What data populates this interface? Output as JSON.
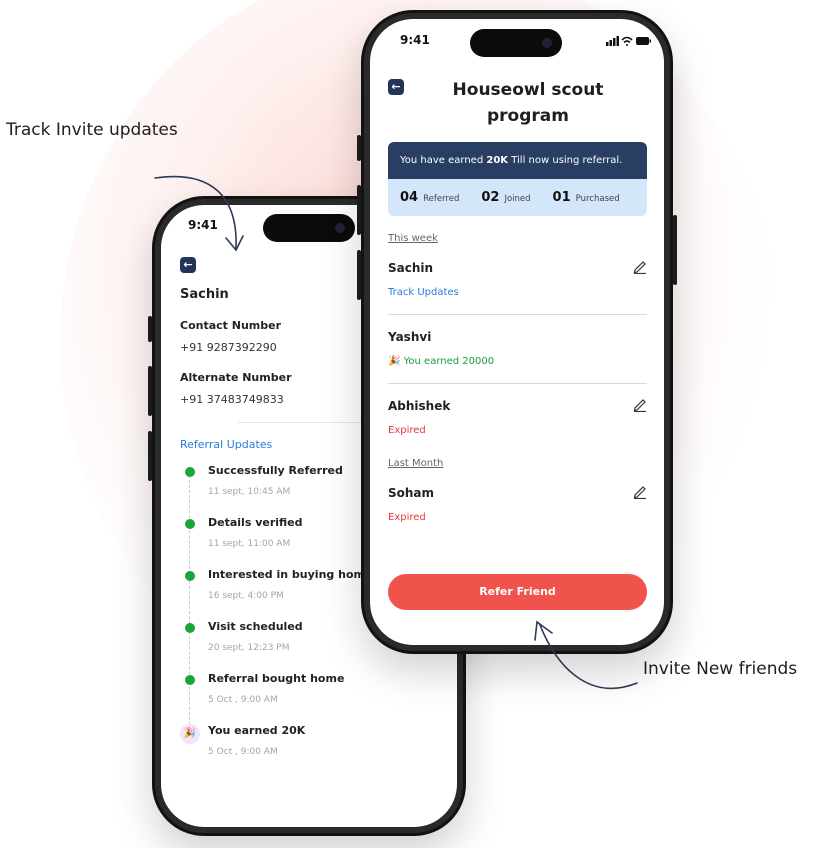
{
  "annotations": {
    "track": "Track Invite updates",
    "invite": "Invite New friends"
  },
  "left_phone": {
    "time": "9:41",
    "name": "Sachin",
    "contact_label": "Contact Number",
    "contact_value": "+91 9287392290",
    "alternate_label": "Alternate Number",
    "alternate_value": "+91 37483749833",
    "section_title": "Referral Updates",
    "timeline": [
      {
        "title": "Successfully Referred",
        "date": "11 sept, 10:45 AM"
      },
      {
        "title": "Details verified",
        "date": "11 sept, 11:00 AM"
      },
      {
        "title": "Interested in buying home",
        "date": "16 sept, 4:00 PM"
      },
      {
        "title": "Visit scheduled",
        "date": "20 sept, 12:23 PM"
      },
      {
        "title": "Referral bought home",
        "date": "5 Oct , 9:00 AM"
      },
      {
        "title": "You earned 20K",
        "date": "5 Oct , 9:00 AM"
      }
    ]
  },
  "right_phone": {
    "time": "9:41",
    "title_line1": "Houseowl scout",
    "title_line2": "program",
    "banner": {
      "prefix": "You have earned ",
      "amount": "20K",
      "suffix": " Till now using referral."
    },
    "stats": [
      {
        "value": "04",
        "label": "Referred"
      },
      {
        "value": "02",
        "label": "Joined"
      },
      {
        "value": "01",
        "label": "Purchased"
      }
    ],
    "this_week_label": "This week",
    "last_month_label": "Last Month",
    "referrals": [
      {
        "name": "Sachin",
        "status": "Track Updates"
      },
      {
        "name": "Yashvi",
        "status": "You earned 20000"
      },
      {
        "name": "Abhishek",
        "status": "Expired"
      },
      {
        "name": "Soham",
        "status": "Expired"
      }
    ],
    "cta_label": "Refer Friend"
  },
  "colors": {
    "navy": "#283e63",
    "light_blue": "#d4e6fa",
    "link_blue": "#2a7bdc",
    "success_green": "#1d9a3c",
    "expired_red": "#e23b3b",
    "cta_red": "#f0524c"
  },
  "icons": [
    "back-arrow-icon",
    "pencil-edit-icon",
    "party-popper-icon",
    "signal-icon",
    "wifi-icon",
    "battery-icon"
  ]
}
